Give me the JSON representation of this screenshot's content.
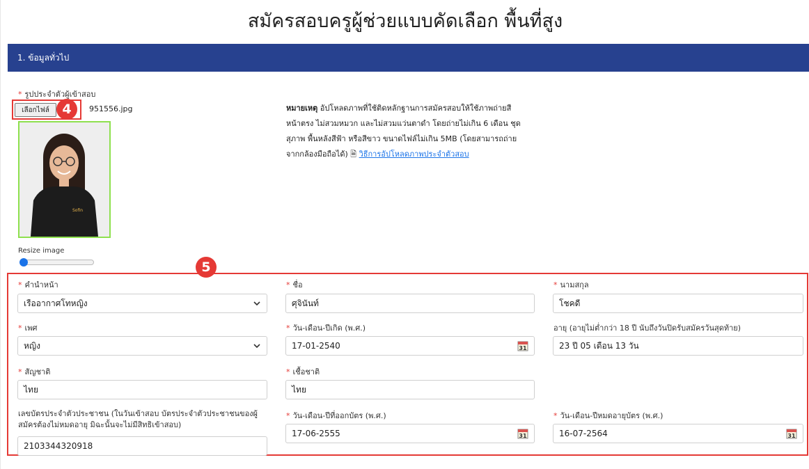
{
  "page": {
    "title": "สมัครสอบครูผู้ช่วยแบบคัดเลือก พื้นที่สูง"
  },
  "section1": {
    "title": "1. ข้อมูลทั่วไป"
  },
  "photo": {
    "label": "รูปประจำตัวผู้เข้าสอบ",
    "choose_file_label": "เลือกไฟล์",
    "file_name": "951556.jpg",
    "resize_label": "Resize image",
    "resize_value_percent": 0
  },
  "note": {
    "title": "หมายเหตุ",
    "text": "อัปโหลดภาพที่ใช้ติดหลักฐานการสมัครสอบให้ใช้ภาพถ่ายสี หน้าตรง ไม่สวมหมวก และไม่สวมแว่นตาดำ โดยถ่ายไม่เกิน 6 เดือน ชุดสุภาพ พื้นหลังสีฟ้า หรือสีขาว ขนาดไฟล์ไม่เกิน 5MB (โดยสามารถถ่ายจากกล้องมือถือได้)",
    "link_text": "วิธีการอัปโหลดภาพประจำตัวสอบ"
  },
  "annotations": {
    "badge4": "4",
    "badge5": "5"
  },
  "form": {
    "prefix": {
      "label": "คำนำหน้า",
      "value": "เรืออากาศโทหญิง"
    },
    "first_name": {
      "label": "ชื่อ",
      "value": "ศุจินันท์"
    },
    "last_name": {
      "label": "นามสกุล",
      "value": "โชคดี"
    },
    "gender": {
      "label": "เพศ",
      "value": "หญิง"
    },
    "birth_date": {
      "label": "วัน-เดือน-ปีเกิด (พ.ศ.)",
      "value": "17-01-2540"
    },
    "age": {
      "label": "อายุ (อายุไม่ต่ำกว่า 18 ปี นับถึงวันปิดรับสมัครวันสุดท้าย)",
      "value": "23 ปี 05 เดือน 13 วัน"
    },
    "nationality": {
      "label": "สัญชาติ",
      "value": "ไทย"
    },
    "ethnicity": {
      "label": "เชื้อชาติ",
      "value": "ไทย"
    },
    "id_card": {
      "label_line1": "เลขบัตรประจำตัวประชาชน (ในวันเข้าสอบ บัตรประจำตัวประชาชนของผู้",
      "label_line2": "สมัครต้องไม่หมดอายุ มิฉะนั้นจะไม่มีสิทธิเข้าสอบ)",
      "value": "2103344320918"
    },
    "issue_date": {
      "label": "วัน-เดือน-ปีที่ออกบัตร (พ.ศ.)",
      "value": "17-06-2555"
    },
    "expiry_date": {
      "label": "วัน-เดือน-ปีหมดอายุบัตร (พ.ศ.)",
      "value": "16-07-2564"
    }
  },
  "icons": {
    "chevron": "chevron-down-icon",
    "calendar": "calendar-icon",
    "calendar_day": "31",
    "document": "document-icon"
  },
  "colors": {
    "header": "#27418f",
    "required": "#e53935",
    "link": "#1a73e8",
    "annotation": "#e53935",
    "photo_border": "#8ee04e"
  }
}
